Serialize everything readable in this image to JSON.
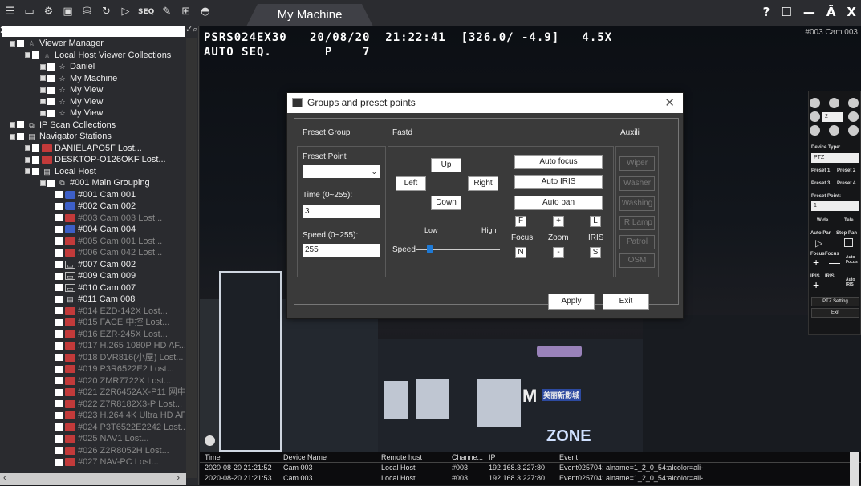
{
  "toolbar": {
    "seq_label": "SEQ",
    "tab_title": "My Machine",
    "help": "?",
    "restore": "☐",
    "minimize": "—",
    "user": "Ä",
    "close": "X"
  },
  "sidebar": {
    "items": [
      {
        "label": "Viewer Manager",
        "indent": 0,
        "icon": "star",
        "dim": false
      },
      {
        "label": "Local Host Viewer Collections",
        "indent": 1,
        "icon": "star",
        "dim": false
      },
      {
        "label": "Daniel",
        "indent": 2,
        "icon": "star",
        "dim": false
      },
      {
        "label": "My Machine",
        "indent": 2,
        "icon": "star",
        "dim": false
      },
      {
        "label": "My View",
        "indent": 2,
        "icon": "star",
        "dim": false
      },
      {
        "label": "My View",
        "indent": 2,
        "icon": "star",
        "dim": false
      },
      {
        "label": "My View",
        "indent": 2,
        "icon": "star",
        "dim": false
      },
      {
        "label": "IP Scan Collections",
        "indent": 0,
        "icon": "net",
        "dim": false
      },
      {
        "label": "Navigator Stations",
        "indent": 0,
        "icon": "grid",
        "dim": false
      },
      {
        "label": "DANIELAPO5F Lost...",
        "indent": 1,
        "icon": "red",
        "dim": false
      },
      {
        "label": "DESKTOP-O126OKF Lost...",
        "indent": 1,
        "icon": "red",
        "dim": false
      },
      {
        "label": "Local Host",
        "indent": 1,
        "icon": "grid",
        "dim": false
      },
      {
        "label": "#001 Main Grouping",
        "indent": 2,
        "icon": "net",
        "dim": false
      },
      {
        "label": "#001 Cam 001",
        "indent": 3,
        "icon": "cam",
        "dim": false
      },
      {
        "label": "#002 Cam 002",
        "indent": 3,
        "icon": "cam",
        "dim": false
      },
      {
        "label": "#003 Cam 003 Lost...",
        "indent": 3,
        "icon": "red",
        "dim": true
      },
      {
        "label": "#004 Cam 004",
        "indent": 3,
        "icon": "cam",
        "dim": false
      },
      {
        "label": "#005 Cam 001 Lost...",
        "indent": 3,
        "icon": "red",
        "dim": true
      },
      {
        "label": "#006 Cam 042 Lost...",
        "indent": 3,
        "icon": "red",
        "dim": true
      },
      {
        "label": "#007 Cam 002",
        "indent": 3,
        "icon": "grey",
        "dim": false
      },
      {
        "label": "#009 Cam 009",
        "indent": 3,
        "icon": "grey",
        "dim": false
      },
      {
        "label": "#010 Cam 007",
        "indent": 3,
        "icon": "grey",
        "dim": false
      },
      {
        "label": "#011 Cam 008",
        "indent": 3,
        "icon": "grid",
        "dim": false
      },
      {
        "label": "#014 EZD-142X Lost...",
        "indent": 3,
        "icon": "red",
        "dim": true
      },
      {
        "label": "#015 FACE 中控 Lost...",
        "indent": 3,
        "icon": "red",
        "dim": true
      },
      {
        "label": "#016 EZR-245X Lost...",
        "indent": 3,
        "icon": "red",
        "dim": true
      },
      {
        "label": "#017 H.265 1080P HD AF...",
        "indent": 3,
        "icon": "red",
        "dim": true
      },
      {
        "label": "#018 DVR816(小屋) Lost...",
        "indent": 3,
        "icon": "red",
        "dim": true
      },
      {
        "label": "#019 P3R6522E2 Lost...",
        "indent": 3,
        "icon": "red",
        "dim": true
      },
      {
        "label": "#020 ZMR7722X Lost...",
        "indent": 3,
        "icon": "red",
        "dim": true
      },
      {
        "label": "#021 Z2R6452AX-P11 网中...",
        "indent": 3,
        "icon": "red",
        "dim": true
      },
      {
        "label": "#022 Z7R8182X3-P Lost...",
        "indent": 3,
        "icon": "red",
        "dim": true
      },
      {
        "label": "#023 H.264 4K Ultra HD AF...",
        "indent": 3,
        "icon": "red",
        "dim": true
      },
      {
        "label": "#024 P3T6522E2242 Lost...",
        "indent": 3,
        "icon": "red",
        "dim": true
      },
      {
        "label": "#025 NAV1 Lost...",
        "indent": 3,
        "icon": "red",
        "dim": true
      },
      {
        "label": "#026 Z2R8052H Lost...",
        "indent": 3,
        "icon": "red",
        "dim": true
      },
      {
        "label": "#027 NAV-PC Lost...",
        "indent": 3,
        "icon": "red",
        "dim": true
      }
    ]
  },
  "viewer": {
    "osd_line1": "PSRS024EX30   20/08/20  21:22:41  [326.0/ -4.9]   4.5X",
    "osd_line2": "AUTO SEQ.       P    7",
    "cam_label": "#003 Cam 003",
    "sign_m": "M",
    "sign_m_text": "美丽新影城",
    "sign_zone": "ZONE"
  },
  "ptz": {
    "device_type_label": "Device Type:",
    "device_type": "PTZ",
    "preset1": "Preset 1",
    "preset2": "Preset 2",
    "preset3": "Preset 3",
    "preset4": "Preset 4",
    "preset_point_label": "Preset Point:",
    "preset_point": "1",
    "wide": "Wide",
    "tele": "Tele",
    "auto_pan": "Auto Pan",
    "stop_pan": "Stop Pan",
    "focus1": "Focus",
    "focus2": "Focus",
    "auto_focus": "Auto Focus",
    "iris1": "IRIS",
    "iris2": "IRIS",
    "auto_iris": "Auto IRIS",
    "ptz_setting": "PTZ Setting",
    "exit": "Exit",
    "pad_value": "2"
  },
  "dialog": {
    "title": "Groups and preset points",
    "preset_group": "Preset Group",
    "fastd": "Fastd",
    "auxili": "Auxili",
    "preset_point": "Preset Point",
    "time_label": "Time (0~255):",
    "time_value": "3",
    "speed_label": "Speed (0~255):",
    "speed_value": "255",
    "up": "Up",
    "left": "Left",
    "right": "Right",
    "down": "Down",
    "low": "Low",
    "high": "High",
    "speed": "Speed",
    "slider_fraction": 0.15,
    "auto_focus": "Auto focus",
    "auto_iris": "Auto IRIS",
    "auto_pan": "Auto pan",
    "f": "F",
    "plus": "+",
    "l": "L",
    "focus": "Focus",
    "zoom": "Zoom",
    "iris": "IRIS",
    "n": "N",
    "minus": "-",
    "s": "S",
    "aux": [
      "Wiper",
      "Washer",
      "Washing",
      "IR Lamp",
      "Patrol",
      "OSM"
    ],
    "apply": "Apply",
    "exit": "Exit"
  },
  "log": {
    "headers": [
      "Time",
      "Device Name",
      "Remote host",
      "Channe...",
      "IP",
      "Event"
    ],
    "rows": [
      [
        "2020-08-20 21:21:52",
        "Cam 003",
        "Local Host",
        "#003",
        "192.168.3.227:80",
        "Event025704: alname=1_2_0_54:alcolor=ali-"
      ],
      [
        "2020-08-20 21:21:53",
        "Cam 003",
        "Local Host",
        "#003",
        "192.168.3.227:80",
        "Event025704: alname=1_2_0_54:alcolor=ali-"
      ]
    ]
  }
}
